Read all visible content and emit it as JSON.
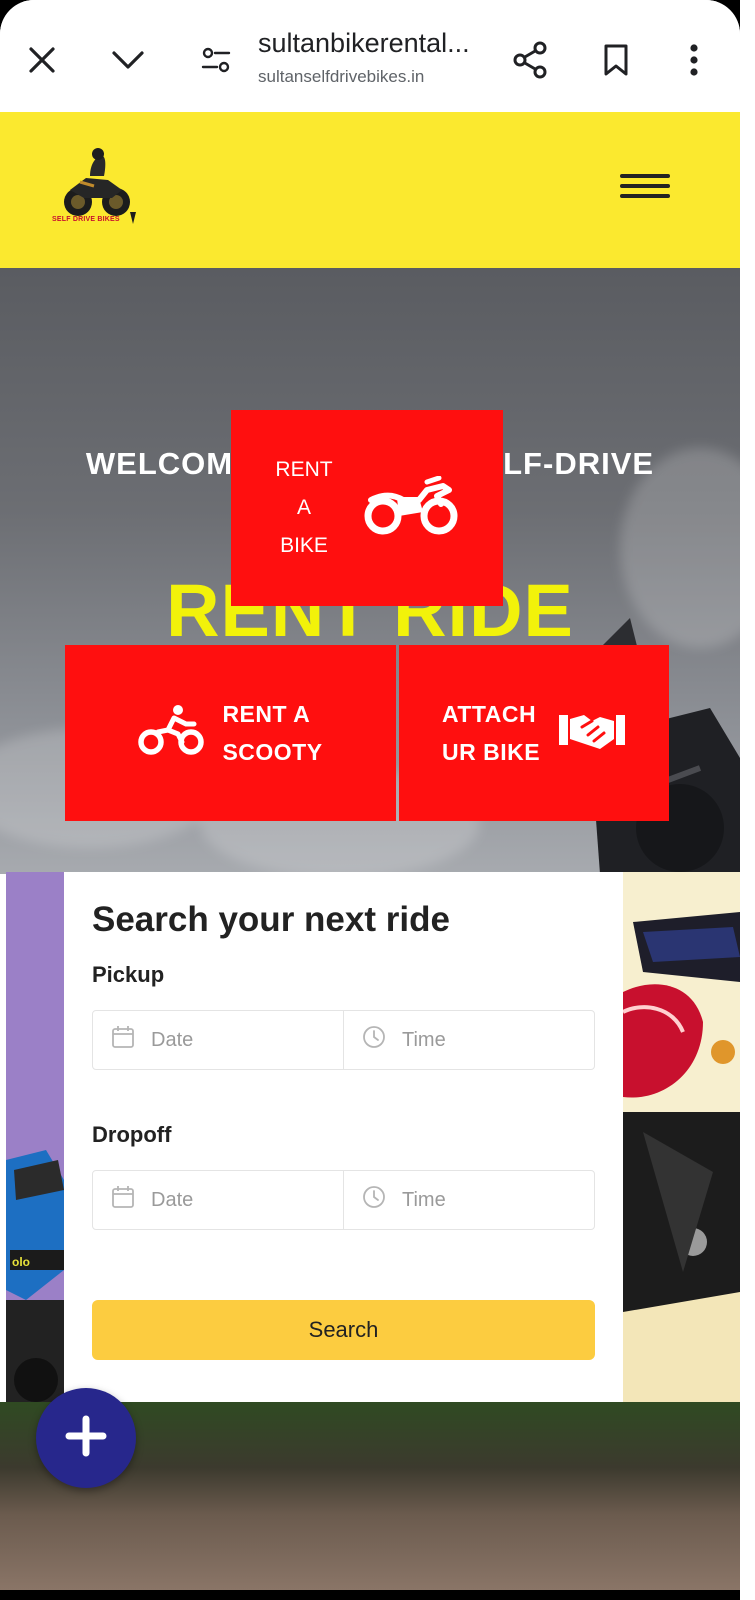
{
  "browser": {
    "page_title": "sultanbikerental...",
    "domain": "sultanselfdrivebikes.in",
    "icons": [
      "close-icon",
      "chevron-down-icon",
      "site-settings-icon",
      "share-icon",
      "bookmark-icon",
      "more-vert-icon"
    ]
  },
  "header": {
    "logo_text": "SELF DRIVE BIKES",
    "menu_icon": "hamburger-icon",
    "background": "#fbe92f"
  },
  "hero": {
    "welcome_left": "WELCOM",
    "welcome_right": "LF-DRIVE",
    "headline": "RENT RIDE",
    "headline_color": "#f2f20a",
    "card_color": "#ff0f0f",
    "rent_bike": {
      "line1": "RENT",
      "line2": "A",
      "line3": "BIKE",
      "icon": "motorcycle-icon"
    },
    "rent_scooty": {
      "line1": "RENT A",
      "line2": "SCOOTY",
      "icon": "scooter-icon"
    },
    "attach_bike": {
      "line1": "ATTACH",
      "line2": "UR BIKE",
      "icon": "handshake-icon"
    }
  },
  "search": {
    "title": "Search your next ride",
    "pickup_label": "Pickup",
    "dropoff_label": "Dropoff",
    "date_placeholder": "Date",
    "time_placeholder": "Time",
    "button_label": "Search",
    "button_color": "#fccc40"
  },
  "fab": {
    "icon": "plus-icon",
    "color": "#27278c"
  }
}
